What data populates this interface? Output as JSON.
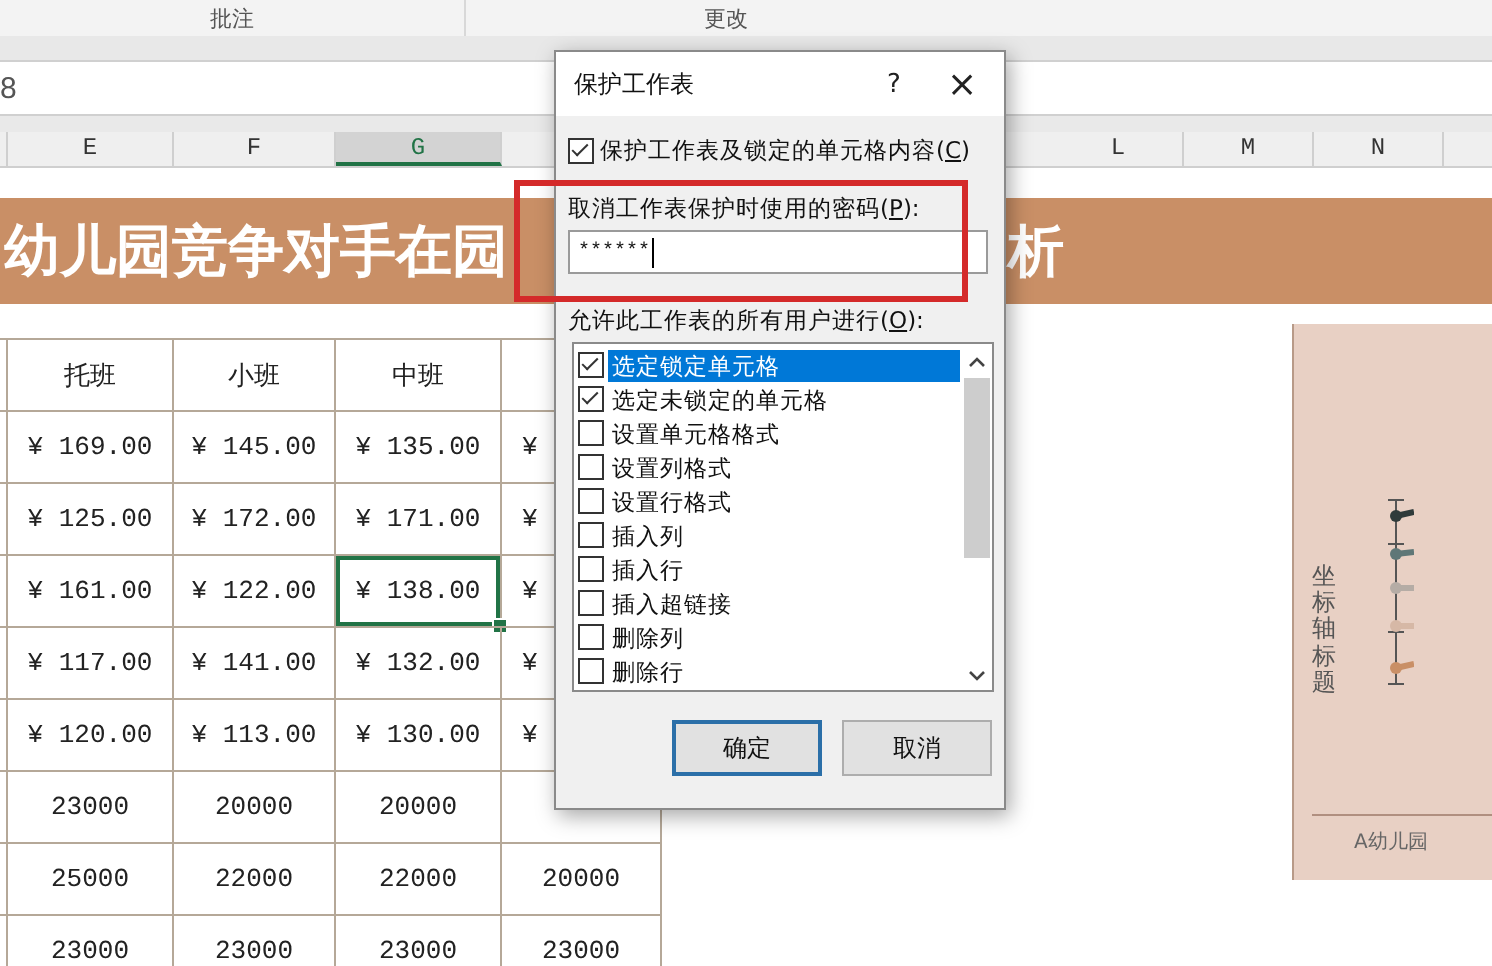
{
  "ribbon": {
    "groups": [
      "批注",
      "更改"
    ]
  },
  "formula_bar": {
    "cell_ref": "8"
  },
  "columns": [
    {
      "label": "E",
      "selected": false
    },
    {
      "label": "F",
      "selected": false
    },
    {
      "label": "G",
      "selected": true
    },
    {
      "label": "L",
      "selected": false
    },
    {
      "label": "M",
      "selected": false
    },
    {
      "label": "N",
      "selected": false
    }
  ],
  "banner": {
    "left_text": "幼儿园竞争对手在园",
    "right_text": "析"
  },
  "table": {
    "rows": [
      {
        "kind": "header",
        "cells": [
          {
            "text": "托班",
            "selected": false
          },
          {
            "text": "小班",
            "selected": false
          },
          {
            "text": "中班",
            "selected": false
          }
        ]
      },
      {
        "kind": "money",
        "cells": [
          {
            "text": "¥ 169.00",
            "selected": false
          },
          {
            "text": "¥ 145.00",
            "selected": false
          },
          {
            "text": "¥ 135.00",
            "selected": false
          },
          {
            "text": "¥",
            "selected": false
          }
        ]
      },
      {
        "kind": "money",
        "cells": [
          {
            "text": "¥ 125.00",
            "selected": false
          },
          {
            "text": "¥ 172.00",
            "selected": false
          },
          {
            "text": "¥ 171.00",
            "selected": false
          },
          {
            "text": "¥",
            "selected": false
          }
        ]
      },
      {
        "kind": "money",
        "cells": [
          {
            "text": "¥ 161.00",
            "selected": false
          },
          {
            "text": "¥ 122.00",
            "selected": false
          },
          {
            "text": "¥ 138.00",
            "selected": true
          },
          {
            "text": "¥",
            "selected": false
          }
        ]
      },
      {
        "kind": "money",
        "cells": [
          {
            "text": "¥ 117.00",
            "selected": false
          },
          {
            "text": "¥ 141.00",
            "selected": false
          },
          {
            "text": "¥ 132.00",
            "selected": false
          },
          {
            "text": "¥",
            "selected": false
          }
        ]
      },
      {
        "kind": "money",
        "cells": [
          {
            "text": "¥ 120.00",
            "selected": false
          },
          {
            "text": "¥ 113.00",
            "selected": false
          },
          {
            "text": "¥ 130.00",
            "selected": false
          },
          {
            "text": "¥",
            "selected": false
          }
        ]
      },
      {
        "kind": "number",
        "cells": [
          {
            "text": "23000",
            "selected": false
          },
          {
            "text": "20000",
            "selected": false
          },
          {
            "text": "20000",
            "selected": false
          }
        ]
      },
      {
        "kind": "number",
        "cells": [
          {
            "text": "25000",
            "selected": false
          },
          {
            "text": "22000",
            "selected": false
          },
          {
            "text": "22000",
            "selected": false
          },
          {
            "text": "20000",
            "selected": false
          }
        ]
      },
      {
        "kind": "number",
        "cells": [
          {
            "text": "23000",
            "selected": false
          },
          {
            "text": "23000",
            "selected": false
          },
          {
            "text": "23000",
            "selected": false
          },
          {
            "text": "23000",
            "selected": false
          }
        ]
      }
    ]
  },
  "chart": {
    "y_axis_title": "坐标轴标题",
    "x_label": "A幼儿园"
  },
  "dialog": {
    "title": "保护工作表",
    "help": "?",
    "close": "×",
    "protect": {
      "text": "保护工作表及锁定的单元格内容(",
      "accel": "C",
      "after": ")",
      "checked": true
    },
    "password_label": {
      "text": "取消工作表保护时使用的密码(",
      "accel": "P",
      "after": "):"
    },
    "password": "******",
    "allow_label": {
      "text": "允许此工作表的所有用户进行(",
      "accel": "O",
      "after": "):"
    },
    "permissions": [
      {
        "label": "选定锁定单元格",
        "checked": true,
        "selected": true
      },
      {
        "label": "选定未锁定的单元格",
        "checked": true,
        "selected": false
      },
      {
        "label": "设置单元格格式",
        "checked": false,
        "selected": false
      },
      {
        "label": "设置列格式",
        "checked": false,
        "selected": false
      },
      {
        "label": "设置行格式",
        "checked": false,
        "selected": false
      },
      {
        "label": "插入列",
        "checked": false,
        "selected": false
      },
      {
        "label": "插入行",
        "checked": false,
        "selected": false
      },
      {
        "label": "插入超链接",
        "checked": false,
        "selected": false
      },
      {
        "label": "删除列",
        "checked": false,
        "selected": false
      },
      {
        "label": "删除行",
        "checked": false,
        "selected": false
      }
    ],
    "buttons": [
      {
        "label": "确定",
        "default": true
      },
      {
        "label": "取消",
        "default": false
      }
    ]
  }
}
